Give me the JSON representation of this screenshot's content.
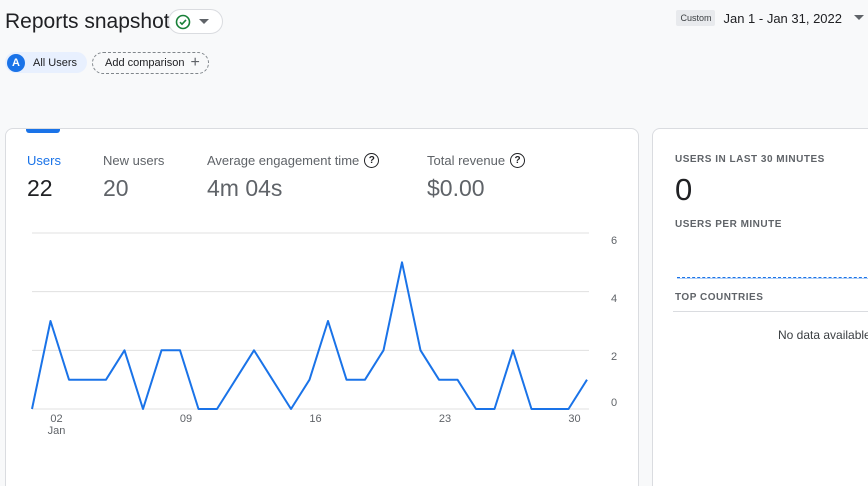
{
  "header": {
    "title": "Reports snapshot",
    "status_icon": "check-circle-icon",
    "dropdown_icon": "caret-down-icon"
  },
  "date_range": {
    "custom_label": "Custom",
    "range": "Jan 1 - Jan 31, 2022"
  },
  "segment": {
    "avatar_letter": "A",
    "label": "All Users"
  },
  "compare": {
    "label": "Add comparison",
    "icon": "plus-icon"
  },
  "metrics": [
    {
      "label": "Users",
      "value": "22",
      "active": true,
      "help": false
    },
    {
      "label": "New users",
      "value": "20",
      "active": false,
      "help": false
    },
    {
      "label": "Average engagement time",
      "value": "4m 04s",
      "active": false,
      "help": true
    },
    {
      "label": "Total revenue",
      "value": "$0.00",
      "active": false,
      "help": true
    }
  ],
  "colors": {
    "accent": "#1a73e8",
    "text": "#202124",
    "muted": "#5f6368",
    "grid": "#e0e0e0"
  },
  "chart_data": {
    "type": "line",
    "x": [
      "01",
      "02",
      "03",
      "04",
      "05",
      "06",
      "07",
      "08",
      "09",
      "10",
      "11",
      "12",
      "13",
      "14",
      "15",
      "16",
      "17",
      "18",
      "19",
      "20",
      "21",
      "22",
      "23",
      "24",
      "25",
      "26",
      "27",
      "28",
      "29",
      "30",
      "31"
    ],
    "x_tick_labels": [
      "02\nJan",
      "09",
      "16",
      "23",
      "30"
    ],
    "y_tick_labels": [
      "6",
      "4",
      "2",
      "0"
    ],
    "values": [
      0,
      3,
      1,
      1,
      1,
      2,
      0,
      2,
      2,
      0,
      0,
      1,
      2,
      1,
      0,
      1,
      3,
      1,
      1,
      2,
      5,
      2,
      1,
      1,
      0,
      0,
      2,
      0,
      0,
      0,
      1
    ],
    "ylim": [
      0,
      6
    ],
    "grid": true,
    "legend": false
  },
  "side_card": {
    "users_30_min_label": "USERS IN LAST 30 MINUTES",
    "users_30_min_value": "0",
    "users_per_minute_label": "USERS PER MINUTE",
    "top_countries_label": "TOP COUNTRIES",
    "no_data_text": "No data available"
  }
}
